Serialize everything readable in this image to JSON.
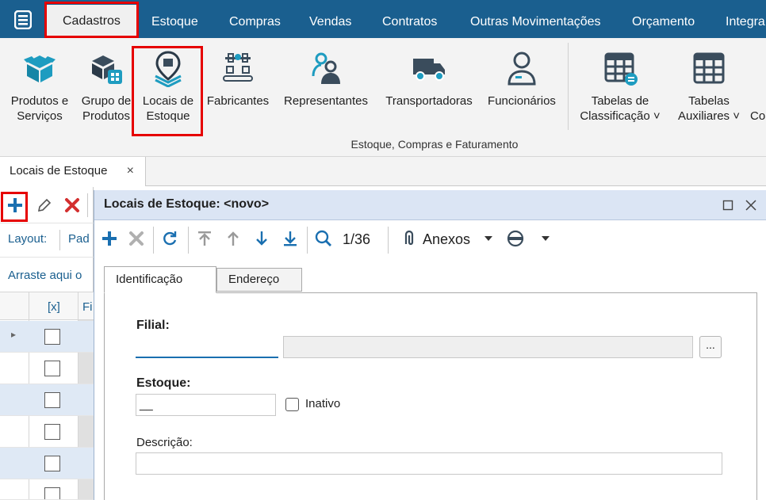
{
  "menu": {
    "items": [
      "Cadastros",
      "Estoque",
      "Compras",
      "Vendas",
      "Contratos",
      "Outras Movimentações",
      "Orçamento",
      "Integra"
    ],
    "active": "Cadastros",
    "app_icon": "app-menu-icon"
  },
  "ribbon": {
    "buttons": [
      {
        "line1": "Produtos e",
        "line2": "Serviços",
        "icon": "box-icon"
      },
      {
        "line1": "Grupo de",
        "line2": "Produtos",
        "icon": "boxes-group-icon"
      },
      {
        "line1": "Locais de",
        "line2": "Estoque",
        "icon": "location-pin-icon"
      },
      {
        "line1": "Fabricantes",
        "line2": "",
        "icon": "factory-icon"
      },
      {
        "line1": "Representantes",
        "line2": "",
        "icon": "representatives-icon"
      },
      {
        "line1": "Transportadoras",
        "line2": "",
        "icon": "truck-icon"
      },
      {
        "line1": "Funcionários",
        "line2": "",
        "icon": "employee-icon"
      },
      {
        "line1": "Tabelas de",
        "line2": "Classificação ˅",
        "icon": "table-classification-icon"
      },
      {
        "line1": "Tabelas",
        "line2": "Auxiliares ˅",
        "icon": "table-auxiliary-icon"
      },
      {
        "line1": "",
        "line2": "Co",
        "icon": ""
      }
    ],
    "group_label": "Estoque, Compras e Faturamento"
  },
  "doc_tabs": [
    {
      "label": "Locais de Estoque",
      "close": "×"
    }
  ],
  "left_panel": {
    "layout_label": "Layout:",
    "layout_value": "Pad",
    "drag_hint": "Arraste aqui o",
    "grid_header_check": "[x]",
    "grid_header_col2": "Fi",
    "row_count": 6,
    "row_marker": "▸"
  },
  "dialog": {
    "title": "Locais de Estoque: <novo>",
    "record_position": "1/36",
    "attachments_label": "Anexos",
    "tabs": [
      "Identificação",
      "Endereço"
    ],
    "active_tab": "Identificação",
    "fields": {
      "filial_label": "Filial:",
      "filial_value": "",
      "filial_desc": "",
      "ellipsis": "...",
      "estoque_label": "Estoque:",
      "estoque_value": "__",
      "inativo_label": "Inativo",
      "inativo_checked": false,
      "descricao_label": "Descrição:",
      "descricao_value": ""
    }
  },
  "colors": {
    "menubar": "#1a5f8f",
    "highlight_box": "#e60000",
    "accent_blue": "#1a6fb0",
    "delete_red": "#d32f2f",
    "title_bar": "#dbe5f4"
  }
}
